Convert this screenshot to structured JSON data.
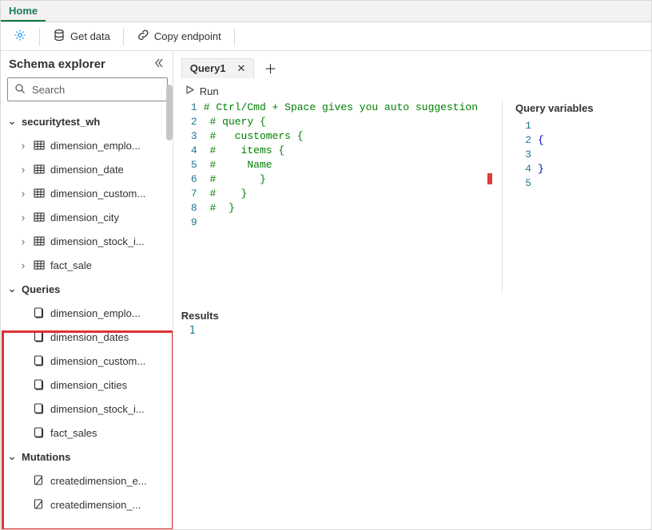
{
  "ribbon": {
    "tabs": [
      "Home"
    ]
  },
  "toolbar": {
    "getData": "Get data",
    "copyEndpoint": "Copy endpoint"
  },
  "sidebar": {
    "title": "Schema explorer",
    "searchPlaceholder": "Search",
    "rootName": "securitytest_wh",
    "tables": [
      "dimension_emplo...",
      "dimension_date",
      "dimension_custom...",
      "dimension_city",
      "dimension_stock_i...",
      "fact_sale"
    ],
    "queriesTitle": "Queries",
    "queries": [
      "dimension_emplo...",
      "dimension_dates",
      "dimension_custom...",
      "dimension_cities",
      "dimension_stock_i...",
      "fact_sales"
    ],
    "mutationsTitle": "Mutations",
    "mutations": [
      "createdimension_e...",
      "createdimension_..."
    ]
  },
  "tabs": {
    "active": "Query1"
  },
  "run": {
    "label": "Run"
  },
  "editor": {
    "lines": [
      "# Ctrl/Cmd + Space gives you auto suggestion",
      " # query {",
      " #   customers {",
      " #    items {",
      " #     Name",
      " #       }",
      " #    }",
      " #  }",
      ""
    ]
  },
  "vars": {
    "title": "Query variables",
    "lines": [
      "",
      "{",
      "",
      "}",
      ""
    ]
  },
  "results": {
    "title": "Results",
    "lines": [
      "1"
    ]
  }
}
